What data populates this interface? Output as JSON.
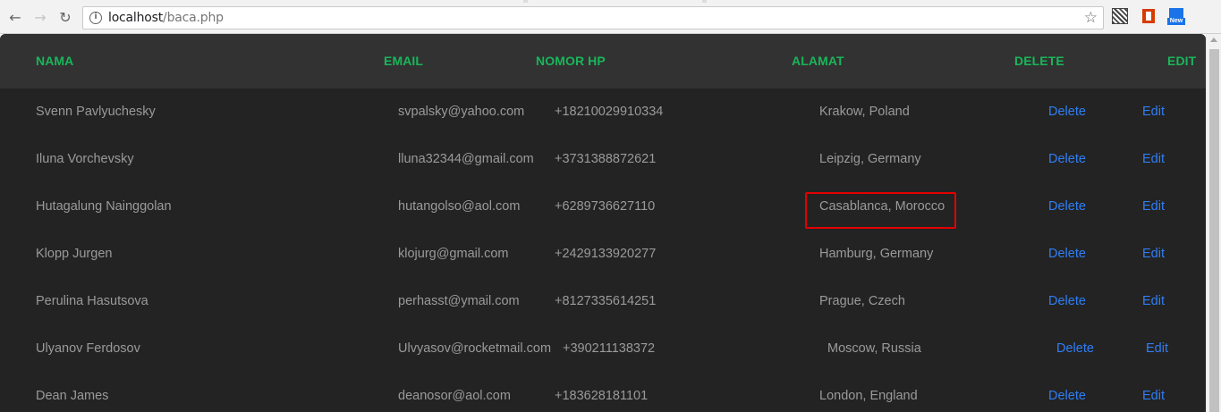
{
  "browser": {
    "url_host": "localhost",
    "url_path": "/baca.php",
    "extension_badge": "New"
  },
  "table": {
    "headers": {
      "nama": "NAMA",
      "email": "EMAIL",
      "nomor_hp": "NOMOR HP",
      "alamat": "ALAMAT",
      "delete": "DELETE",
      "edit": "EDIT"
    },
    "rows": [
      {
        "nama": "Svenn Pavlyuchesky",
        "email": "svpalsky@yahoo.com",
        "hp": "+18210029910334",
        "alamat": "Krakow, Poland",
        "delete": "Delete",
        "edit": "Edit"
      },
      {
        "nama": "Iluna Vorchevsky",
        "email": "lluna32344@gmail.com",
        "hp": "+3731388872621",
        "alamat": "Leipzig, Germany",
        "delete": "Delete",
        "edit": "Edit"
      },
      {
        "nama": "Hutagalung Nainggolan",
        "email": "hutangolso@aol.com",
        "hp": "+6289736627110",
        "alamat": "Casablanca, Morocco",
        "delete": "Delete",
        "edit": "Edit"
      },
      {
        "nama": "Klopp Jurgen",
        "email": "klojurg@gmail.com",
        "hp": "+2429133920277",
        "alamat": "Hamburg, Germany",
        "delete": "Delete",
        "edit": "Edit"
      },
      {
        "nama": "Perulina Hasutsova",
        "email": "perhasst@ymail.com",
        "hp": "+8127335614251",
        "alamat": "Prague, Czech",
        "delete": "Delete",
        "edit": "Edit"
      },
      {
        "nama": "Ulyanov Ferdosov",
        "email": "Ulvyasov@rocketmail.com",
        "hp": "+390211138372",
        "alamat": "Moscow, Russia",
        "delete": "Delete",
        "edit": "Edit"
      },
      {
        "nama": "Dean James",
        "email": "deanosor@aol.com",
        "hp": "+183628181101",
        "alamat": "London, England",
        "delete": "Delete",
        "edit": "Edit"
      }
    ]
  },
  "colors": {
    "header_text": "#19b65a",
    "link": "#2f7ef5",
    "body_text": "#9a9a9a",
    "panel_bg": "#232323",
    "header_bg": "#323232",
    "highlight_box": "#e30000"
  }
}
